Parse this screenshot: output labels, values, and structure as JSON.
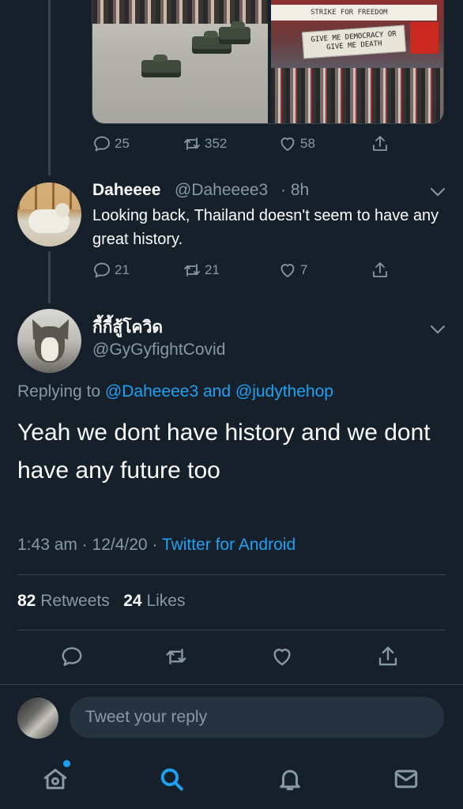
{
  "previous_tweet": {
    "media": {
      "left_banner": "STRIKE FOR FREEDOM",
      "right_banner": "GIVE ME DEMOCRACY OR GIVE ME DEATH"
    },
    "actions": {
      "replies": "25",
      "retweets": "352",
      "likes": "58"
    }
  },
  "reply_tweet": {
    "name": "Daheeee",
    "handle": "@Daheeee3",
    "time": "· 8h",
    "text": "Looking back, Thailand doesn't seem to have any great history.",
    "actions": {
      "replies": "21",
      "retweets": "21",
      "likes": "7"
    }
  },
  "main_tweet": {
    "name": "กี้กี้สู้โควิด",
    "handle": "@GyGyfightCovid",
    "replying_prefix": "Replying to ",
    "replying_user1": "@Daheeee3",
    "replying_and": " and ",
    "replying_user2": "@judythehop",
    "text": "Yeah we dont have history and we dont have any future too",
    "time": "1:43 am · 12/4/20 · ",
    "source": "Twitter for Android",
    "retweets_count": "82",
    "retweets_label": " Retweets",
    "likes_count": "24",
    "likes_label": " Likes"
  },
  "composer": {
    "placeholder": "Tweet your reply"
  },
  "tabbar": {
    "items": [
      "home-icon",
      "search-icon",
      "notifications-icon",
      "messages-icon"
    ],
    "active": "search-icon",
    "accent": "#1da1f2"
  },
  "colors": {
    "background": "#15202b",
    "muted": "#8899a6",
    "accent": "#1da1f2",
    "divider": "#38444d"
  }
}
